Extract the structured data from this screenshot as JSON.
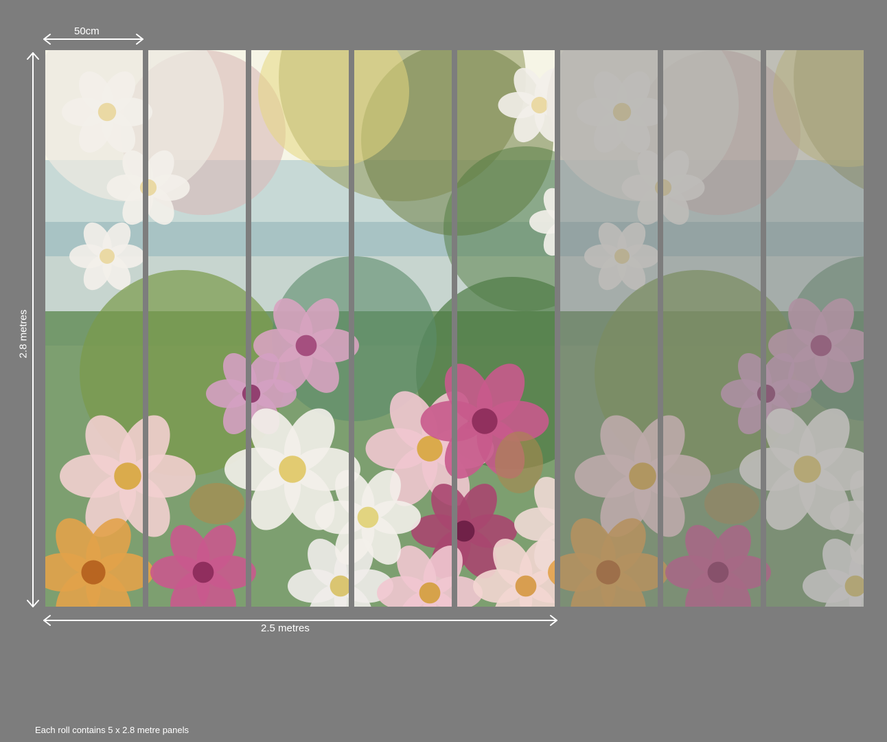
{
  "dimensions": {
    "panel_width_label": "50cm",
    "height_label": "2.8 metres",
    "total_width_label": "2.5 metres"
  },
  "footnote": "Each roll contains  5 x 2.8 metre panels",
  "mural": {
    "panel_count_full": 5,
    "panel_count_faded": 3,
    "colors": {
      "background": "#7d7d7d",
      "divider": "#7d7d7d",
      "arrow": "#ffffff",
      "pink": "#c85a8c",
      "white_flower": "#f3f0ea",
      "foliage": "#5f8a52",
      "sky": "#f6f5e6",
      "mist": "#8fb7c3"
    }
  }
}
